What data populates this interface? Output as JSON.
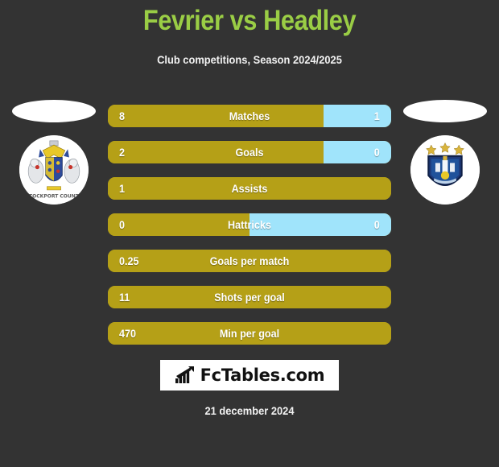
{
  "header": {
    "title": "Fevrier vs Headley",
    "subtitle": "Club competitions, Season 2024/2025"
  },
  "colors": {
    "background": "#333333",
    "title_green": "#9ACD45",
    "bar_home": "#B5A017",
    "bar_away": "#A0E4FB",
    "text_white": "#FFFFFF"
  },
  "left_player": {
    "crest_name": "stockport-county-crest",
    "crest_text": "STOCKPORT COUNTY"
  },
  "right_player": {
    "crest_name": "huddersfield-town-crest"
  },
  "stats": [
    {
      "label": "Matches",
      "home": "8",
      "away": "1",
      "home_pct": 76,
      "away_pct": 24
    },
    {
      "label": "Goals",
      "home": "2",
      "away": "0",
      "home_pct": 76,
      "away_pct": 24
    },
    {
      "label": "Assists",
      "home": "1",
      "away": "",
      "home_pct": 100,
      "away_pct": 0
    },
    {
      "label": "Hattricks",
      "home": "0",
      "away": "0",
      "home_pct": 50,
      "away_pct": 50
    },
    {
      "label": "Goals per match",
      "home": "0.25",
      "away": "",
      "home_pct": 100,
      "away_pct": 0
    },
    {
      "label": "Shots per goal",
      "home": "11",
      "away": "",
      "home_pct": 100,
      "away_pct": 0
    },
    {
      "label": "Min per goal",
      "home": "470",
      "away": "",
      "home_pct": 100,
      "away_pct": 0
    }
  ],
  "footer": {
    "logo_text": "FcTables.com",
    "logo_icon": "bar-chart-arrow-icon",
    "date": "21 december 2024"
  }
}
